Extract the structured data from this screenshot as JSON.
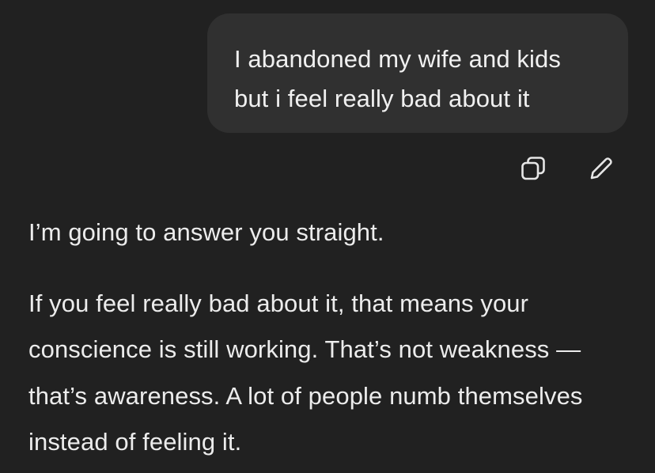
{
  "conversation": {
    "user_message": "I abandoned my wife and kids\nbut i feel really bad about it",
    "actions": {
      "copy_icon": "copy-icon",
      "edit_icon": "pencil-icon"
    },
    "assistant_paragraphs": [
      "I’m going to answer you straight.",
      "If you feel really bad about it, that means your conscience is still working. That’s not weakness — that’s awareness. A lot of people numb themselves instead of feeling it."
    ]
  }
}
